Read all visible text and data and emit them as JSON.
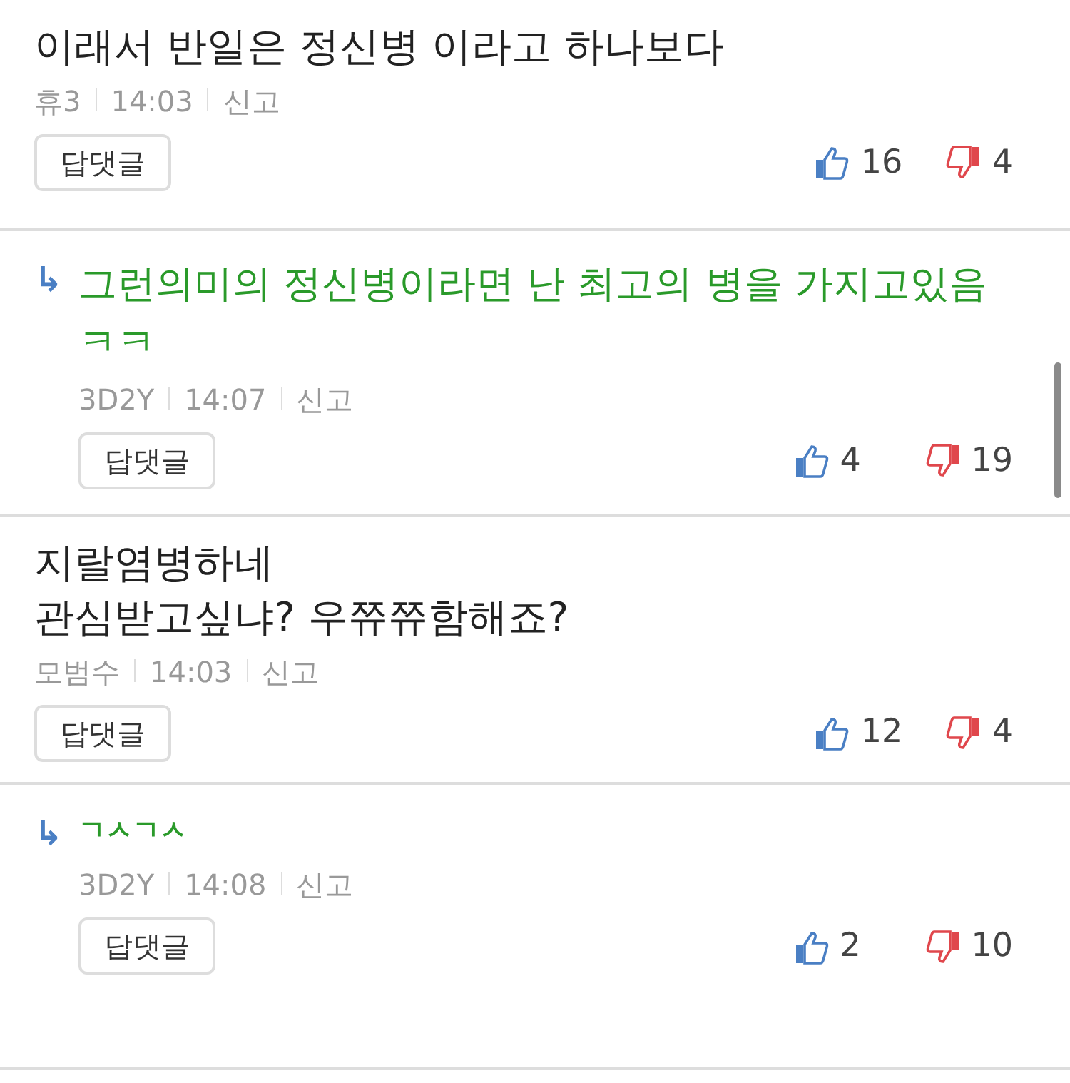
{
  "comments": [
    {
      "kind": "comment",
      "text": "이래서 반일은 정신병 이라고 하나보다",
      "author": "휴3",
      "time": "14:03",
      "report": "신고",
      "reply_button": "답댓글",
      "likes": "16",
      "dislikes": "4"
    },
    {
      "kind": "reply",
      "arrow": "↳",
      "text": "그런의미의 정신병이라면 난 최고의 병을 가지고있음 ㅋㅋ",
      "author": "3D2Y",
      "time": "14:07",
      "report": "신고",
      "reply_button": "답댓글",
      "likes": "4",
      "dislikes": "19"
    },
    {
      "kind": "comment",
      "text": "지랄염병하네\n관심받고싶냐? 우쮸쮸함해죠?",
      "author": "모범수",
      "time": "14:03",
      "report": "신고",
      "reply_button": "답댓글",
      "likes": "12",
      "dislikes": "4"
    },
    {
      "kind": "reply",
      "arrow": "↳",
      "text": "ㄱㅅㄱㅅ",
      "author": "3D2Y",
      "time": "14:08",
      "report": "신고",
      "reply_button": "답댓글",
      "likes": "2",
      "dislikes": "10"
    }
  ]
}
